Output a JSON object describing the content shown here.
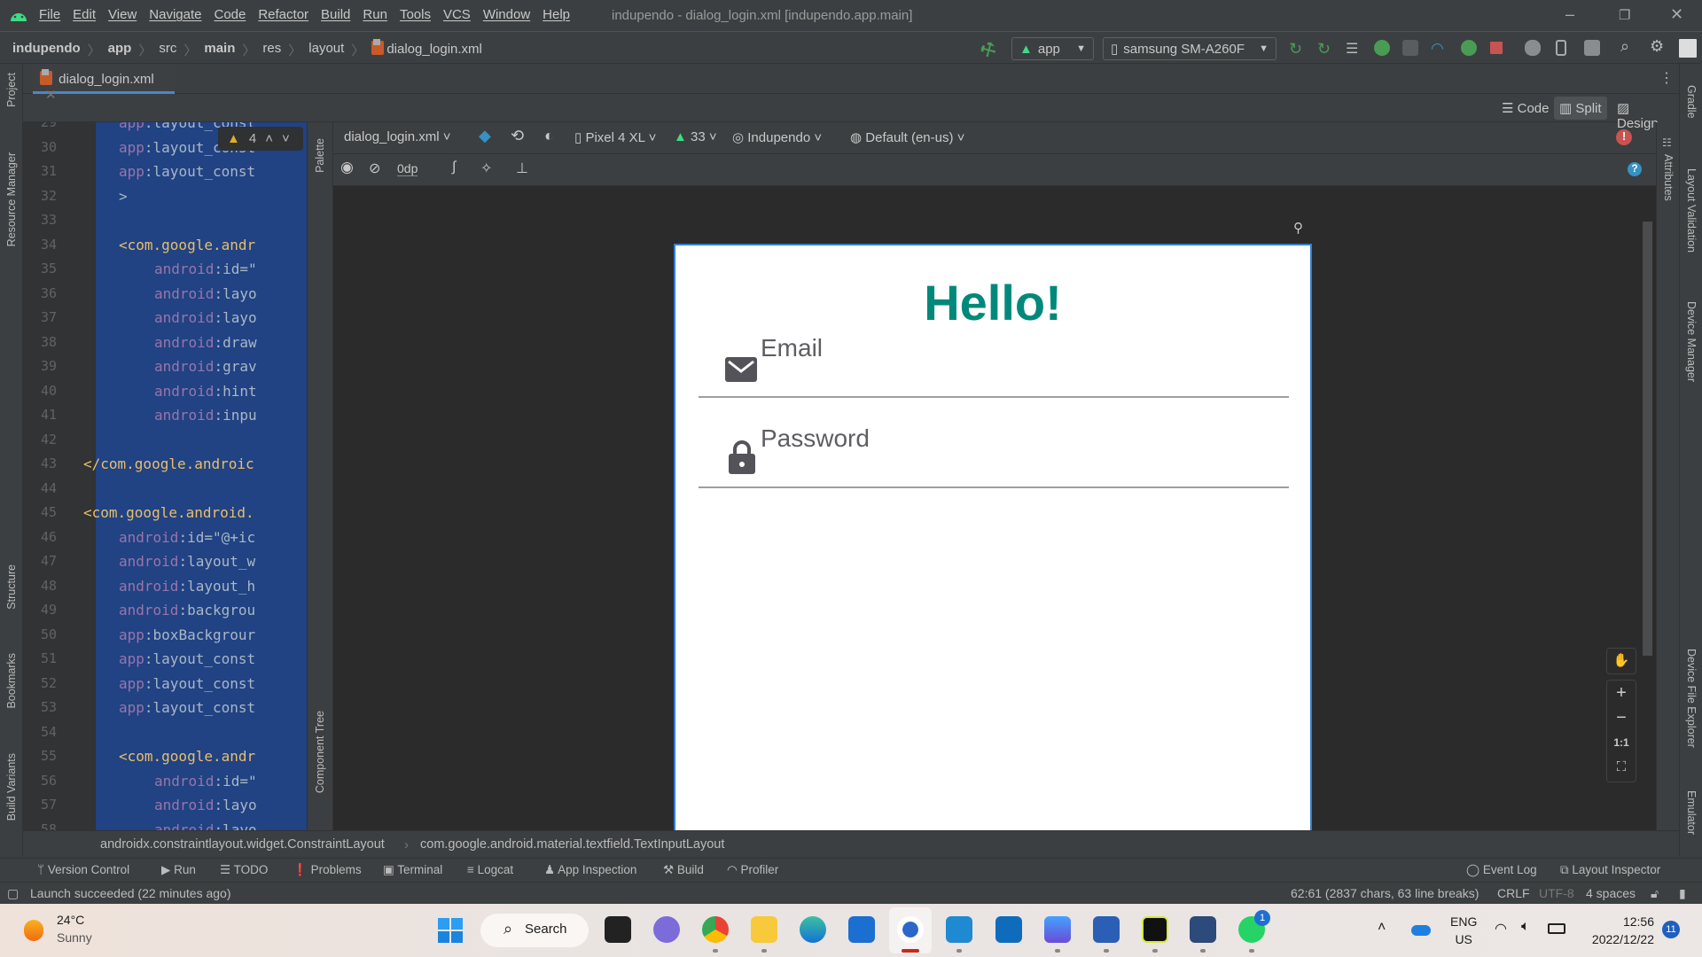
{
  "window": {
    "title": "indupendo - dialog_login.xml [indupendo.app.main]",
    "menu": [
      "File",
      "Edit",
      "View",
      "Navigate",
      "Code",
      "Refactor",
      "Build",
      "Run",
      "Tools",
      "VCS",
      "Window",
      "Help"
    ]
  },
  "breadcrumb": [
    "indupendo",
    "app",
    "src",
    "main",
    "res",
    "layout",
    "dialog_login.xml"
  ],
  "run_config": {
    "module": "app",
    "device": "samsung SM-A260F"
  },
  "tab": {
    "label": "dialog_login.xml"
  },
  "view_modes": {
    "code": "Code",
    "split": "Split",
    "design": "Design",
    "active": "Split"
  },
  "left_stripe": [
    "Project",
    "Resource Manager",
    "Structure",
    "Bookmarks",
    "Build Variants"
  ],
  "right_stripe": [
    "Gradle",
    "Layout Validation",
    "Device Manager",
    "Device File Explorer",
    "Emulator"
  ],
  "attributes_label": "Attributes",
  "palette_label": "Palette",
  "component_tree_label": "Component Tree",
  "warnings": {
    "count": "4"
  },
  "editor": {
    "lines": [
      {
        "n": "29",
        "indent": 8,
        "ns": "app",
        "rest": ":layout_const",
        "kind": "attr"
      },
      {
        "n": "30",
        "indent": 8,
        "ns": "app",
        "rest": ":layout_const",
        "kind": "attr"
      },
      {
        "n": "31",
        "indent": 8,
        "ns": "app",
        "rest": ":layout_const",
        "kind": "attr"
      },
      {
        "n": "32",
        "indent": 8,
        "ns": "",
        "rest": ">",
        "kind": "plain"
      },
      {
        "n": "33",
        "indent": 0,
        "ns": "",
        "rest": "",
        "kind": "plain"
      },
      {
        "n": "34",
        "indent": 8,
        "ns": "",
        "rest": "<com.google.andr",
        "kind": "tag"
      },
      {
        "n": "35",
        "indent": 12,
        "ns": "android",
        "rest": ":id=\"",
        "kind": "attr"
      },
      {
        "n": "36",
        "indent": 12,
        "ns": "android",
        "rest": ":layo",
        "kind": "attr"
      },
      {
        "n": "37",
        "indent": 12,
        "ns": "android",
        "rest": ":layo",
        "kind": "attr"
      },
      {
        "n": "38",
        "indent": 12,
        "ns": "android",
        "rest": ":draw",
        "kind": "attr"
      },
      {
        "n": "39",
        "indent": 12,
        "ns": "android",
        "rest": ":grav",
        "kind": "attr"
      },
      {
        "n": "40",
        "indent": 12,
        "ns": "android",
        "rest": ":hint",
        "kind": "attr"
      },
      {
        "n": "41",
        "indent": 12,
        "ns": "android",
        "rest": ":inpu",
        "kind": "attr"
      },
      {
        "n": "42",
        "indent": 0,
        "ns": "",
        "rest": "",
        "kind": "plain"
      },
      {
        "n": "43",
        "indent": 4,
        "ns": "",
        "rest": "</com.google.androic",
        "kind": "tag"
      },
      {
        "n": "44",
        "indent": 0,
        "ns": "",
        "rest": "",
        "kind": "plain"
      },
      {
        "n": "45",
        "indent": 4,
        "ns": "",
        "rest": "<com.google.android.",
        "kind": "tag"
      },
      {
        "n": "46",
        "indent": 8,
        "ns": "android",
        "rest": ":id=\"@+ic",
        "kind": "attr"
      },
      {
        "n": "47",
        "indent": 8,
        "ns": "android",
        "rest": ":layout_w",
        "kind": "attr"
      },
      {
        "n": "48",
        "indent": 8,
        "ns": "android",
        "rest": ":layout_h",
        "kind": "attr"
      },
      {
        "n": "49",
        "indent": 8,
        "ns": "android",
        "rest": ":backgrou",
        "kind": "attr"
      },
      {
        "n": "50",
        "indent": 8,
        "ns": "app",
        "rest": ":boxBackgrour",
        "kind": "attr"
      },
      {
        "n": "51",
        "indent": 8,
        "ns": "app",
        "rest": ":layout_const",
        "kind": "attr"
      },
      {
        "n": "52",
        "indent": 8,
        "ns": "app",
        "rest": ":layout_const",
        "kind": "attr"
      },
      {
        "n": "53",
        "indent": 8,
        "ns": "app",
        "rest": ":layout_const",
        "kind": "attr"
      },
      {
        "n": "54",
        "indent": 0,
        "ns": "",
        "rest": "",
        "kind": "plain"
      },
      {
        "n": "55",
        "indent": 8,
        "ns": "",
        "rest": "<com.google.andr",
        "kind": "tag"
      },
      {
        "n": "56",
        "indent": 12,
        "ns": "android",
        "rest": ":id=\"",
        "kind": "attr"
      },
      {
        "n": "57",
        "indent": 12,
        "ns": "android",
        "rest": ":layo",
        "kind": "attr"
      },
      {
        "n": "58",
        "indent": 12,
        "ns": "android",
        "rest": ":layo",
        "kind": "attr"
      }
    ]
  },
  "design_toolbar": {
    "file": "dialog_login.xml",
    "device": "Pixel 4 XL",
    "api": "33",
    "theme": "Indupendo",
    "locale": "Default (en-us)",
    "margin": "0dp"
  },
  "preview": {
    "title": "Hello!",
    "email_hint": "Email",
    "password_hint": "Password",
    "accent": "#00897b"
  },
  "zoom_controls": {
    "one_to_one": "1:1"
  },
  "component_path": [
    "androidx.constraintlayout.widget.ConstraintLayout",
    "com.google.android.material.textfield.TextInputLayout"
  ],
  "tool_windows": [
    "Version Control",
    "Run",
    "TODO",
    "Problems",
    "Terminal",
    "Logcat",
    "App Inspection",
    "Build",
    "Profiler"
  ],
  "tool_windows_right": [
    "Event Log",
    "Layout Inspector"
  ],
  "status": {
    "message": "Launch succeeded (22 minutes ago)",
    "position": "62:61 (2837 chars, 63 line breaks)",
    "line_sep": "CRLF",
    "encoding": "UTF-8",
    "indent": "4 spaces"
  },
  "taskbar": {
    "weather_temp": "24°C",
    "weather_desc": "Sunny",
    "search": "Search",
    "lang1": "ENG",
    "lang2": "US",
    "time": "12:56",
    "date": "2022/12/22",
    "notifications": "11",
    "whatsapp_badge": "1"
  }
}
